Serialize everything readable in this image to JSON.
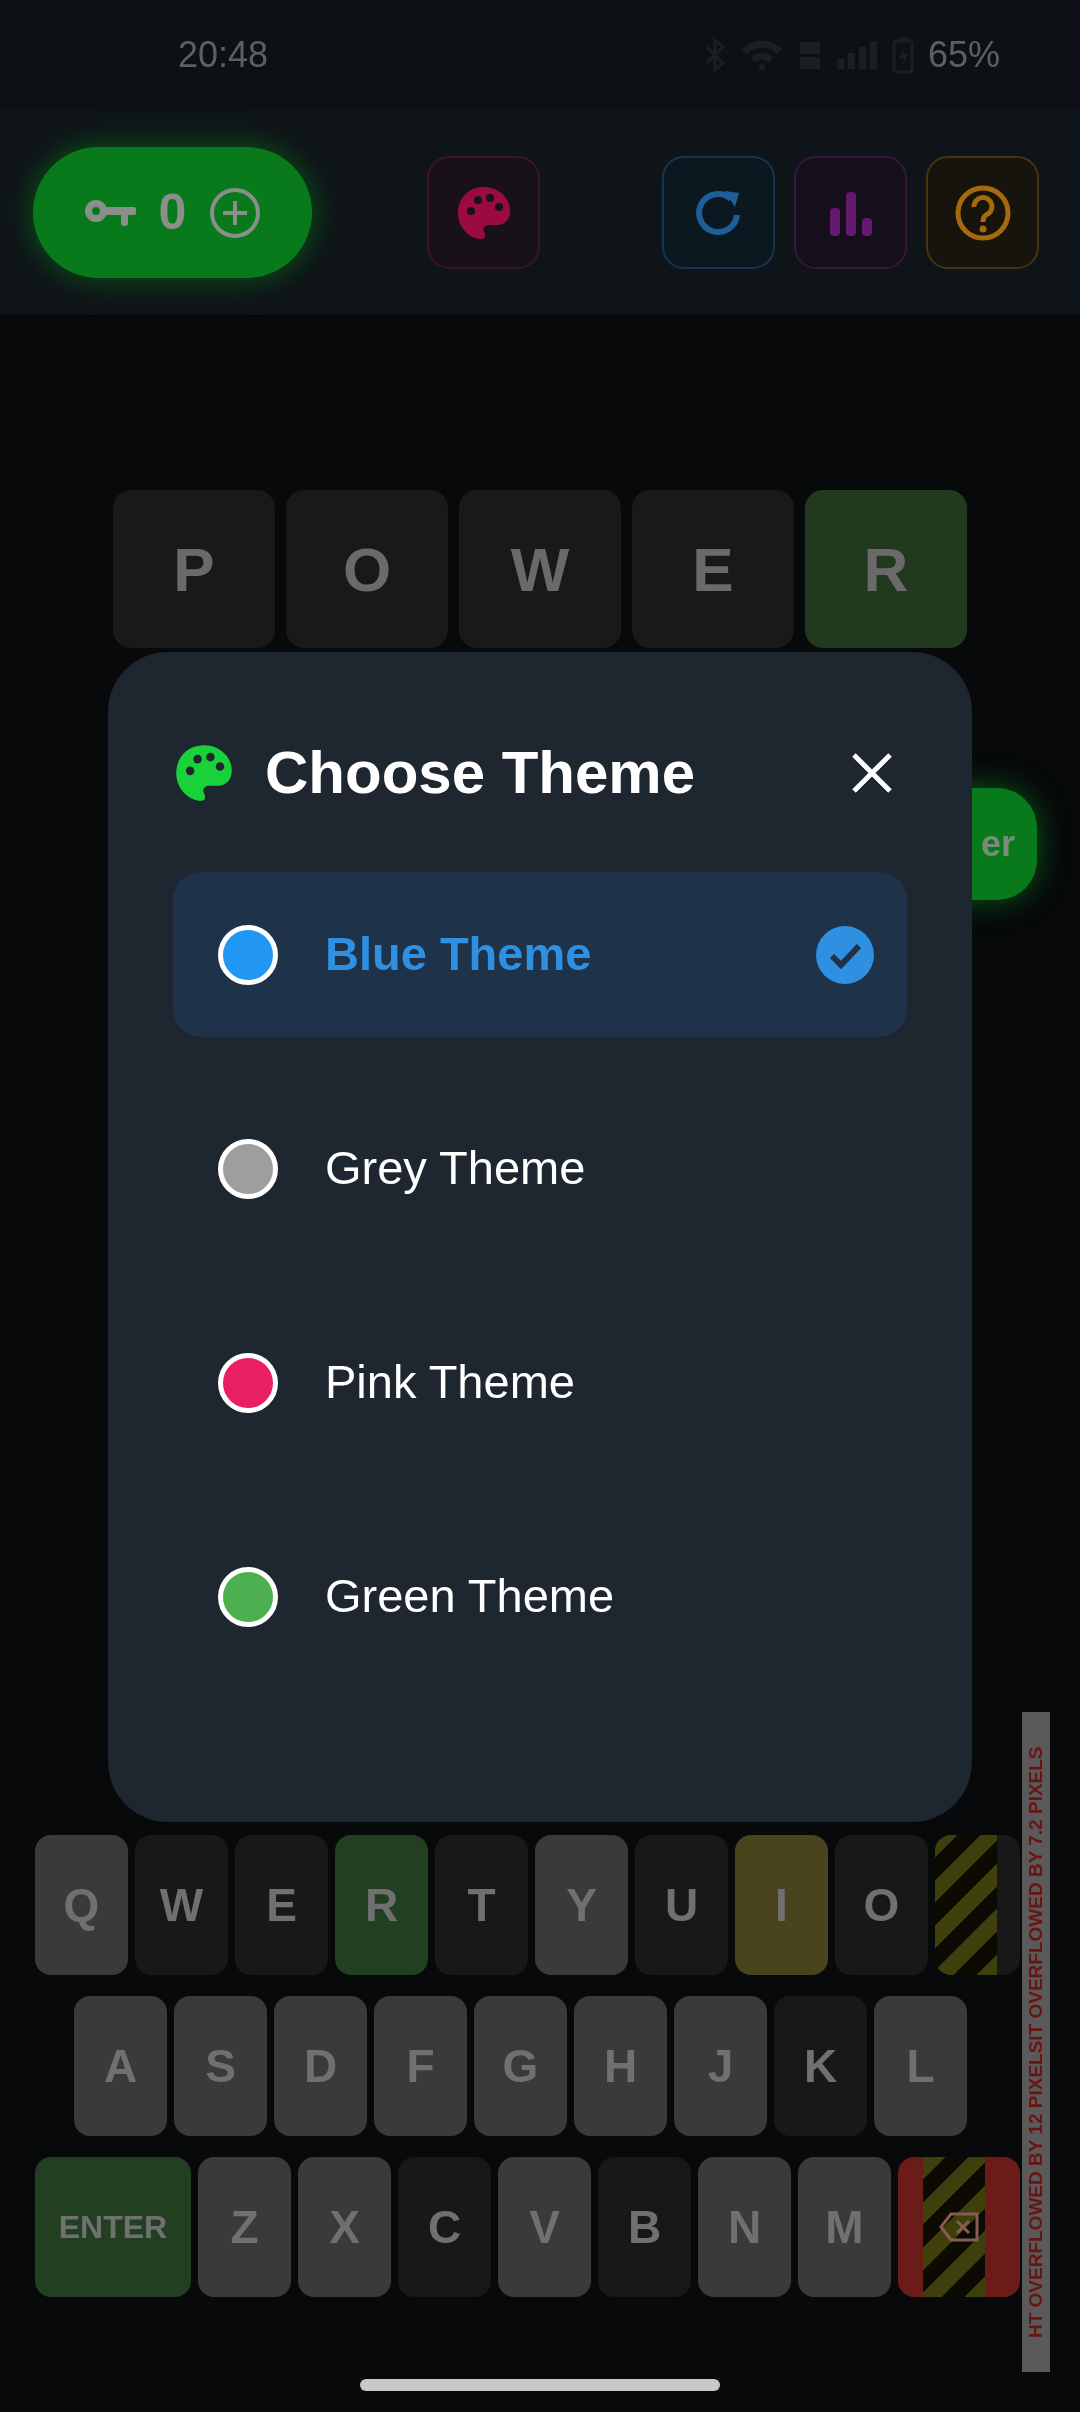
{
  "status_bar": {
    "time": "20:48",
    "battery": "65%"
  },
  "toolbar": {
    "keys_count": "0"
  },
  "board": {
    "tiles": [
      {
        "letter": "P",
        "color": "#191919"
      },
      {
        "letter": "O",
        "color": "#191919"
      },
      {
        "letter": "W",
        "color": "#191919"
      },
      {
        "letter": "E",
        "color": "#191919"
      },
      {
        "letter": "R",
        "color": "#213a1f"
      }
    ]
  },
  "partial_button": {
    "label": "er"
  },
  "dialog": {
    "title": "Choose Theme",
    "options": [
      {
        "label": "Blue Theme",
        "color": "#2196f3",
        "selected": true
      },
      {
        "label": "Grey Theme",
        "color": "#9e9e9e",
        "selected": false
      },
      {
        "label": "Pink Theme",
        "color": "#e91e63",
        "selected": false
      },
      {
        "label": "Green Theme",
        "color": "#4caf50",
        "selected": false
      }
    ]
  },
  "keyboard": {
    "rows": [
      [
        {
          "kind": "letter",
          "label": "Q",
          "color": "#3a3a3a"
        },
        {
          "kind": "letter",
          "label": "W",
          "color": "#181818"
        },
        {
          "kind": "letter",
          "label": "E",
          "color": "#181818"
        },
        {
          "kind": "letter",
          "label": "R",
          "color": "#233f21"
        },
        {
          "kind": "letter",
          "label": "T",
          "color": "#181818"
        },
        {
          "kind": "letter",
          "label": "Y",
          "color": "#3a3a3a"
        },
        {
          "kind": "letter",
          "label": "U",
          "color": "#181818"
        },
        {
          "kind": "letter",
          "label": "I",
          "color": "#4a441e"
        },
        {
          "kind": "letter",
          "label": "O",
          "color": "#181818"
        },
        {
          "kind": "letter",
          "color": "#181818",
          "overflow": true
        }
      ],
      [
        {
          "kind": "letter",
          "label": "A",
          "color": "#3a3a3a"
        },
        {
          "kind": "letter",
          "label": "S",
          "color": "#3a3a3a"
        },
        {
          "kind": "letter",
          "label": "D",
          "color": "#3a3a3a"
        },
        {
          "kind": "letter",
          "label": "F",
          "color": "#3a3a3a"
        },
        {
          "kind": "letter",
          "label": "G",
          "color": "#3a3a3a"
        },
        {
          "kind": "letter",
          "label": "H",
          "color": "#3a3a3a"
        },
        {
          "kind": "letter",
          "label": "J",
          "color": "#3a3a3a"
        },
        {
          "kind": "letter",
          "label": "K",
          "color": "#181818"
        },
        {
          "kind": "letter",
          "label": "L",
          "color": "#3a3a3a"
        }
      ],
      [
        {
          "kind": "enter",
          "label": "ENTER",
          "color": "#233f21"
        },
        {
          "kind": "letter",
          "label": "Z",
          "color": "#3a3a3a"
        },
        {
          "kind": "letter",
          "label": "X",
          "color": "#3a3a3a"
        },
        {
          "kind": "letter",
          "label": "C",
          "color": "#181818"
        },
        {
          "kind": "letter",
          "label": "V",
          "color": "#3a3a3a"
        },
        {
          "kind": "letter",
          "label": "B",
          "color": "#181818"
        },
        {
          "kind": "letter",
          "label": "N",
          "color": "#3a3a3a"
        },
        {
          "kind": "letter",
          "label": "M",
          "color": "#3a3a3a"
        },
        {
          "kind": "backspace",
          "color": "#6b1c18",
          "overflow": true
        }
      ]
    ]
  },
  "debug_banner": {
    "text": "HT OVERFLOWED BY 12 PIXELSIT OVERFLOWED BY 7.2 PIXELS"
  }
}
